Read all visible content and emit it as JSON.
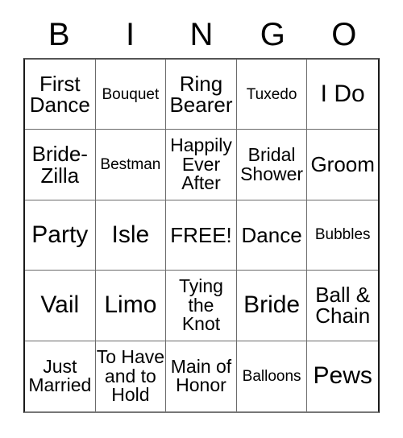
{
  "card": {
    "header": {
      "letters": [
        "B",
        "I",
        "N",
        "G",
        "O"
      ]
    },
    "free_space_label": "FREE!",
    "cells": [
      {
        "text": "First\nDance",
        "size": "lg"
      },
      {
        "text": "Bouquet",
        "size": "sm"
      },
      {
        "text": "Ring\nBearer",
        "size": "lg"
      },
      {
        "text": "Tuxedo",
        "size": "sm"
      },
      {
        "text": "I Do",
        "size": "xl"
      },
      {
        "text": "Bride-\nZilla",
        "size": "lg"
      },
      {
        "text": "Bestman",
        "size": "sm"
      },
      {
        "text": "Happily\nEver\nAfter",
        "size": "md"
      },
      {
        "text": "Bridal\nShower",
        "size": "md"
      },
      {
        "text": "Groom",
        "size": "lg"
      },
      {
        "text": "Party",
        "size": "xl"
      },
      {
        "text": "Isle",
        "size": "xl"
      },
      {
        "text": "FREE!",
        "size": "lg"
      },
      {
        "text": "Dance",
        "size": "lg"
      },
      {
        "text": "Bubbles",
        "size": "sm"
      },
      {
        "text": "Vail",
        "size": "xl"
      },
      {
        "text": "Limo",
        "size": "xl"
      },
      {
        "text": "Tying\nthe\nKnot",
        "size": "md"
      },
      {
        "text": "Bride",
        "size": "xl"
      },
      {
        "text": "Ball &\nChain",
        "size": "lg"
      },
      {
        "text": "Just\nMarried",
        "size": "md"
      },
      {
        "text": "To Have\nand to\nHold",
        "size": "md"
      },
      {
        "text": "Main of\nHonor",
        "size": "md"
      },
      {
        "text": "Balloons",
        "size": "sm"
      },
      {
        "text": "Pews",
        "size": "xl"
      }
    ]
  }
}
